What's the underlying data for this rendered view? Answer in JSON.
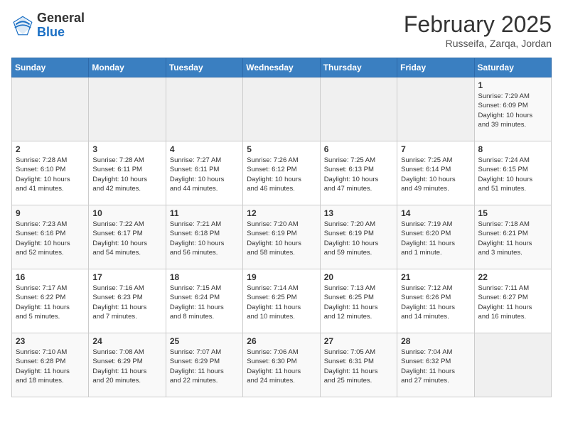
{
  "header": {
    "logo_line1": "General",
    "logo_line2": "Blue",
    "month": "February 2025",
    "location": "Russeifa, Zarqa, Jordan"
  },
  "weekdays": [
    "Sunday",
    "Monday",
    "Tuesday",
    "Wednesday",
    "Thursday",
    "Friday",
    "Saturday"
  ],
  "weeks": [
    [
      {
        "day": "",
        "content": ""
      },
      {
        "day": "",
        "content": ""
      },
      {
        "day": "",
        "content": ""
      },
      {
        "day": "",
        "content": ""
      },
      {
        "day": "",
        "content": ""
      },
      {
        "day": "",
        "content": ""
      },
      {
        "day": "1",
        "content": "Sunrise: 7:29 AM\nSunset: 6:09 PM\nDaylight: 10 hours\nand 39 minutes."
      }
    ],
    [
      {
        "day": "2",
        "content": "Sunrise: 7:28 AM\nSunset: 6:10 PM\nDaylight: 10 hours\nand 41 minutes."
      },
      {
        "day": "3",
        "content": "Sunrise: 7:28 AM\nSunset: 6:11 PM\nDaylight: 10 hours\nand 42 minutes."
      },
      {
        "day": "4",
        "content": "Sunrise: 7:27 AM\nSunset: 6:11 PM\nDaylight: 10 hours\nand 44 minutes."
      },
      {
        "day": "5",
        "content": "Sunrise: 7:26 AM\nSunset: 6:12 PM\nDaylight: 10 hours\nand 46 minutes."
      },
      {
        "day": "6",
        "content": "Sunrise: 7:25 AM\nSunset: 6:13 PM\nDaylight: 10 hours\nand 47 minutes."
      },
      {
        "day": "7",
        "content": "Sunrise: 7:25 AM\nSunset: 6:14 PM\nDaylight: 10 hours\nand 49 minutes."
      },
      {
        "day": "8",
        "content": "Sunrise: 7:24 AM\nSunset: 6:15 PM\nDaylight: 10 hours\nand 51 minutes."
      }
    ],
    [
      {
        "day": "9",
        "content": "Sunrise: 7:23 AM\nSunset: 6:16 PM\nDaylight: 10 hours\nand 52 minutes."
      },
      {
        "day": "10",
        "content": "Sunrise: 7:22 AM\nSunset: 6:17 PM\nDaylight: 10 hours\nand 54 minutes."
      },
      {
        "day": "11",
        "content": "Sunrise: 7:21 AM\nSunset: 6:18 PM\nDaylight: 10 hours\nand 56 minutes."
      },
      {
        "day": "12",
        "content": "Sunrise: 7:20 AM\nSunset: 6:19 PM\nDaylight: 10 hours\nand 58 minutes."
      },
      {
        "day": "13",
        "content": "Sunrise: 7:20 AM\nSunset: 6:19 PM\nDaylight: 10 hours\nand 59 minutes."
      },
      {
        "day": "14",
        "content": "Sunrise: 7:19 AM\nSunset: 6:20 PM\nDaylight: 11 hours\nand 1 minute."
      },
      {
        "day": "15",
        "content": "Sunrise: 7:18 AM\nSunset: 6:21 PM\nDaylight: 11 hours\nand 3 minutes."
      }
    ],
    [
      {
        "day": "16",
        "content": "Sunrise: 7:17 AM\nSunset: 6:22 PM\nDaylight: 11 hours\nand 5 minutes."
      },
      {
        "day": "17",
        "content": "Sunrise: 7:16 AM\nSunset: 6:23 PM\nDaylight: 11 hours\nand 7 minutes."
      },
      {
        "day": "18",
        "content": "Sunrise: 7:15 AM\nSunset: 6:24 PM\nDaylight: 11 hours\nand 8 minutes."
      },
      {
        "day": "19",
        "content": "Sunrise: 7:14 AM\nSunset: 6:25 PM\nDaylight: 11 hours\nand 10 minutes."
      },
      {
        "day": "20",
        "content": "Sunrise: 7:13 AM\nSunset: 6:25 PM\nDaylight: 11 hours\nand 12 minutes."
      },
      {
        "day": "21",
        "content": "Sunrise: 7:12 AM\nSunset: 6:26 PM\nDaylight: 11 hours\nand 14 minutes."
      },
      {
        "day": "22",
        "content": "Sunrise: 7:11 AM\nSunset: 6:27 PM\nDaylight: 11 hours\nand 16 minutes."
      }
    ],
    [
      {
        "day": "23",
        "content": "Sunrise: 7:10 AM\nSunset: 6:28 PM\nDaylight: 11 hours\nand 18 minutes."
      },
      {
        "day": "24",
        "content": "Sunrise: 7:08 AM\nSunset: 6:29 PM\nDaylight: 11 hours\nand 20 minutes."
      },
      {
        "day": "25",
        "content": "Sunrise: 7:07 AM\nSunset: 6:29 PM\nDaylight: 11 hours\nand 22 minutes."
      },
      {
        "day": "26",
        "content": "Sunrise: 7:06 AM\nSunset: 6:30 PM\nDaylight: 11 hours\nand 24 minutes."
      },
      {
        "day": "27",
        "content": "Sunrise: 7:05 AM\nSunset: 6:31 PM\nDaylight: 11 hours\nand 25 minutes."
      },
      {
        "day": "28",
        "content": "Sunrise: 7:04 AM\nSunset: 6:32 PM\nDaylight: 11 hours\nand 27 minutes."
      },
      {
        "day": "",
        "content": ""
      }
    ]
  ]
}
